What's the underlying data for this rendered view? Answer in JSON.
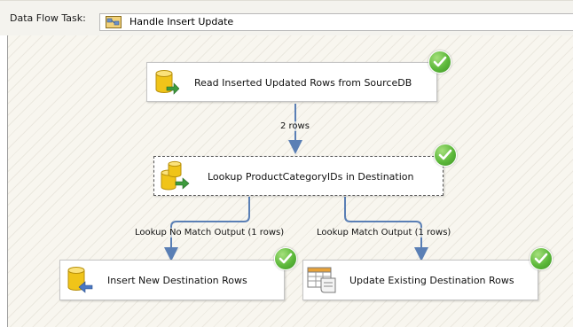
{
  "toolbar": {
    "label": "Data Flow Task:",
    "selected_task": "Handle Insert Update"
  },
  "nodes": {
    "read": {
      "label": "Read Inserted Updated Rows from SourceDB",
      "icon": "database-source-icon",
      "status": "success"
    },
    "lookup": {
      "label": "Lookup ProductCategoryIDs in Destination",
      "icon": "lookup-icon",
      "status": "success"
    },
    "insert": {
      "label": "Insert New Destination Rows",
      "icon": "database-destination-icon",
      "status": "success"
    },
    "update": {
      "label": "Update Existing Destination Rows",
      "icon": "ole-db-command-icon",
      "status": "success"
    }
  },
  "connectors": {
    "read_to_lookup": "2 rows",
    "no_match": "Lookup No Match Output (1 rows)",
    "match": "Lookup Match Output (1 rows)"
  },
  "colors": {
    "path": "#5a7fb5",
    "success": "#5cb83a",
    "canvas": "#f8f6ef"
  }
}
